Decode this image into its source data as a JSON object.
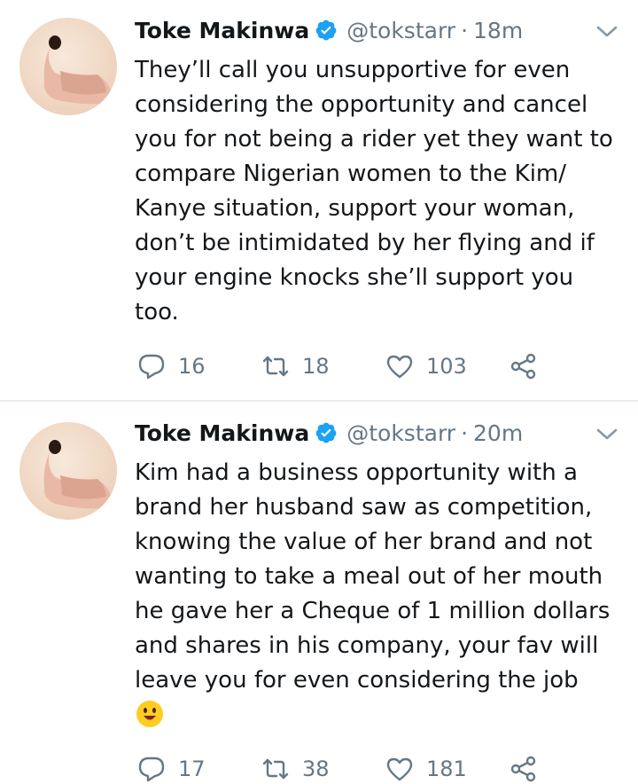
{
  "tweets": [
    {
      "author_name": "Toke Makinwa",
      "handle": "@tokstarr",
      "separator": "·",
      "time": "18m",
      "text": "They’ll call you unsupportive for even\nconsidering the opportunity and cancel\nyou for not being a rider yet they want to\ncompare Nigerian women to the Kim/\nKanye situation, support your woman,\ndon’t be intimidated by her flying and if\nyour engine knocks she’ll support you\ntoo.",
      "replies": "16",
      "retweets": "18",
      "likes": "103"
    },
    {
      "author_name": "Toke Makinwa",
      "handle": "@tokstarr",
      "separator": "·",
      "time": "20m",
      "text": "Kim had a business opportunity with a\nbrand her husband saw as competition,\nknowing the value of her brand and not\nwanting to take a meal out of her mouth\nhe gave her a Cheque of 1 million dollars\nand shares in his company, your fav will\nleave you for even considering the job",
      "emoji": "smiling-face-icon",
      "replies": "17",
      "retweets": "38",
      "likes": "181"
    }
  ],
  "colors": {
    "text": "#14171a",
    "secondary": "#657786",
    "verified": "#1da1f2",
    "divider": "#e6ecf0"
  },
  "icons": [
    "verified-badge-icon",
    "chevron-down-icon",
    "reply-icon",
    "retweet-icon",
    "like-icon",
    "share-icon"
  ]
}
